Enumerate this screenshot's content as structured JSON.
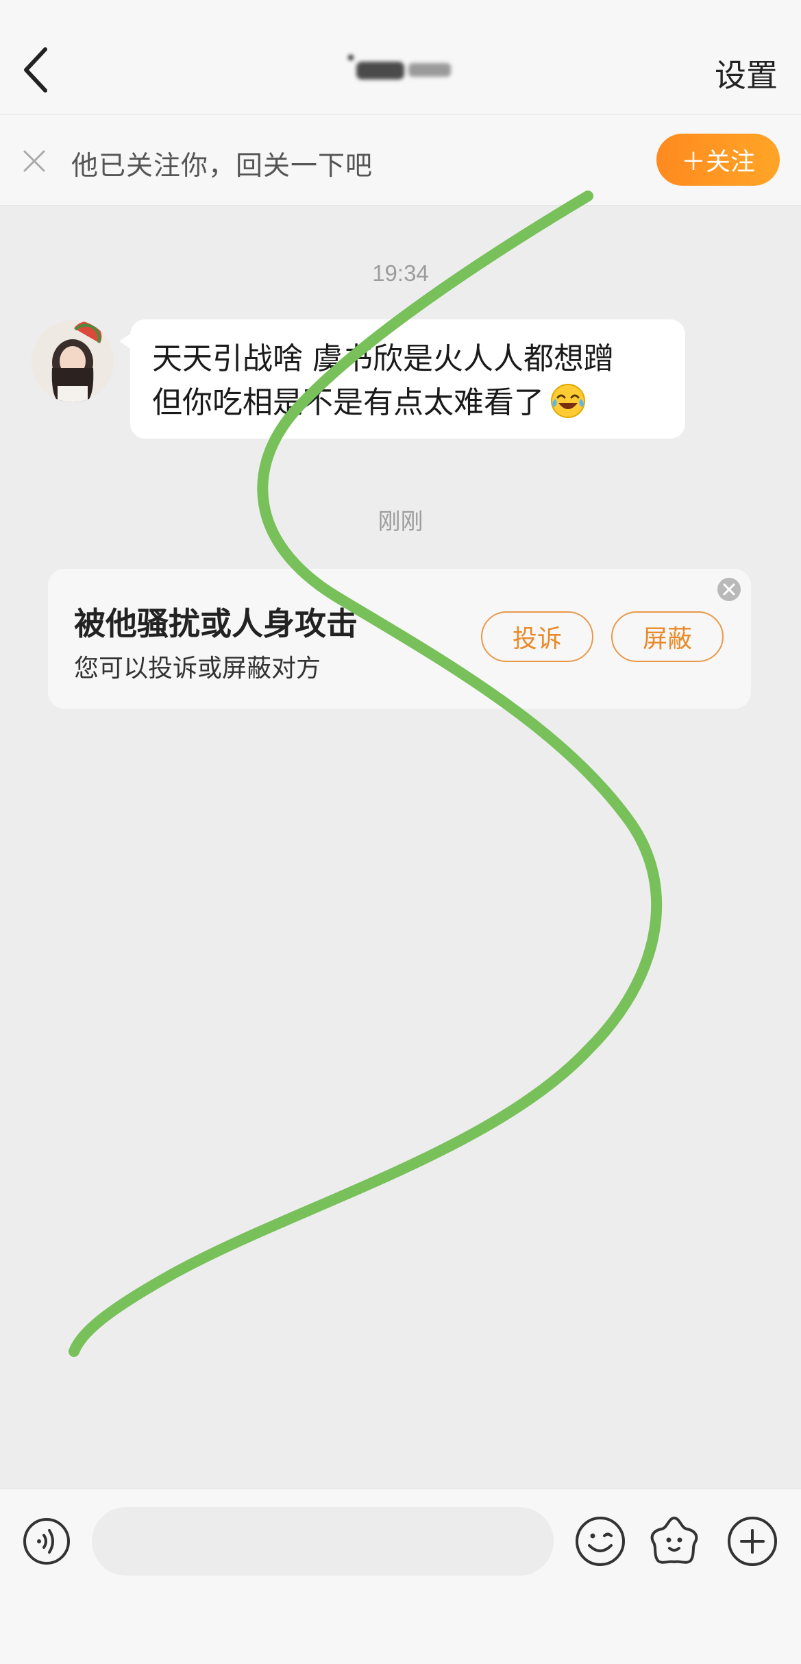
{
  "header": {
    "title": "",
    "settings_label": "设置"
  },
  "follow_bar": {
    "text": "他已关注你，回关一下吧",
    "button_label": "＋关注"
  },
  "messages": [
    {
      "timestamp": "19:34",
      "text_line1": "天天引战啥 虞书欣是火人人都想蹭",
      "text_line2": "但你吃相是不是有点太难看了"
    }
  ],
  "system": {
    "timestamp": "刚刚",
    "card_title": "被他骚扰或人身攻击",
    "card_subtitle": "您可以投诉或屏蔽对方",
    "report_label": "投诉",
    "block_label": "屏蔽"
  },
  "input": {
    "placeholder": ""
  },
  "colors": {
    "accent_orange": "#ff8f1f",
    "button_outline": "#e9994a",
    "scribble_green": "#77c05a",
    "background": "#ededed"
  },
  "icons": {
    "back": "back-icon",
    "close": "close-icon",
    "voice": "voice-icon",
    "emoji": "emoji-icon",
    "sticker": "sticker-icon",
    "plus": "plus-icon"
  }
}
